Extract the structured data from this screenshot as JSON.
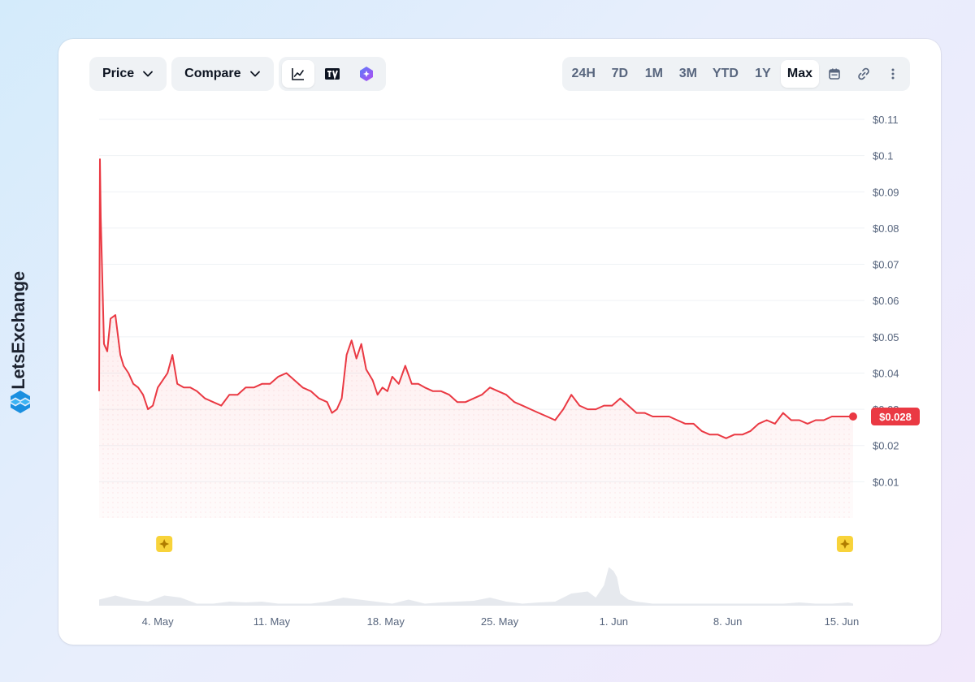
{
  "brand": {
    "name": "LetsExchange"
  },
  "toolbar": {
    "price_label": "Price",
    "compare_label": "Compare",
    "chart_modes": [
      "line-chart-icon",
      "tradingview-icon",
      "ai-icon"
    ],
    "ranges": [
      "24H",
      "7D",
      "1M",
      "3M",
      "YTD",
      "1Y",
      "Max"
    ],
    "active_range": "Max"
  },
  "colors": {
    "line": "#ea3943",
    "grid": "#eff2f5",
    "volume": "#e6e9ee",
    "event_marker": "#f8d33a"
  },
  "chart_data": {
    "type": "area",
    "currency_prefix": "$",
    "ylim": [
      0.0,
      0.11
    ],
    "yticks": [
      "$0.11",
      "$0.1",
      "$0.09",
      "$0.08",
      "$0.07",
      "$0.06",
      "$0.05",
      "$0.04",
      "$0.03",
      "$0.02",
      "$0.01"
    ],
    "ytick_values": [
      0.11,
      0.1,
      0.09,
      0.08,
      0.07,
      0.06,
      0.05,
      0.04,
      0.03,
      0.02,
      0.01
    ],
    "xticks": [
      "4. May",
      "11. May",
      "18. May",
      "25. May",
      "1. Jun",
      "8. Jun",
      "15. Jun"
    ],
    "xtick_days": [
      3.6,
      10.6,
      17.6,
      24.6,
      31.6,
      38.6,
      45.6
    ],
    "x_range_days": [
      0,
      47
    ],
    "series": [
      {
        "x": [
          0,
          0.05,
          0.1,
          0.3,
          0.5,
          0.7,
          1.0,
          1.3,
          1.5,
          1.8,
          2.1,
          2.4,
          2.7,
          3.0,
          3.3,
          3.6,
          3.9,
          4.2,
          4.5,
          4.8,
          5.2,
          5.6,
          6.0,
          6.5,
          7.0,
          7.5,
          8.0,
          8.5,
          9.0,
          9.5,
          10.0,
          10.5,
          11.0,
          11.5,
          12.0,
          12.5,
          13.0,
          13.5,
          14.0,
          14.3,
          14.6,
          14.9,
          15.2,
          15.5,
          15.8,
          16.1,
          16.4,
          16.8,
          17.1,
          17.4,
          17.7,
          18.0,
          18.4,
          18.8,
          19.2,
          19.6,
          20.0,
          20.5,
          21.0,
          21.5,
          22.0,
          22.5,
          23.0,
          23.5,
          24.0,
          24.5,
          25.0,
          25.5,
          26.0,
          26.5,
          27.0,
          27.5,
          28.0,
          28.5,
          29.0,
          29.5,
          30.0,
          30.5,
          31.0,
          31.5,
          32.0,
          32.5,
          33.0,
          33.5,
          34.0,
          34.5,
          35.0,
          35.5,
          36.0,
          36.5,
          37.0,
          37.5,
          38.0,
          38.5,
          39.0,
          39.5,
          40.0,
          40.5,
          41.0,
          41.5,
          42.0,
          42.5,
          43.0,
          43.5,
          44.0,
          44.5,
          45.0,
          45.5,
          46.0,
          46.3
        ],
        "y": [
          0.035,
          0.099,
          0.083,
          0.048,
          0.046,
          0.055,
          0.056,
          0.045,
          0.042,
          0.04,
          0.037,
          0.036,
          0.034,
          0.03,
          0.031,
          0.036,
          0.038,
          0.04,
          0.045,
          0.037,
          0.036,
          0.036,
          0.035,
          0.033,
          0.032,
          0.031,
          0.034,
          0.034,
          0.036,
          0.036,
          0.037,
          0.037,
          0.039,
          0.04,
          0.038,
          0.036,
          0.035,
          0.033,
          0.032,
          0.029,
          0.03,
          0.033,
          0.045,
          0.049,
          0.044,
          0.048,
          0.041,
          0.038,
          0.034,
          0.036,
          0.035,
          0.039,
          0.037,
          0.042,
          0.037,
          0.037,
          0.036,
          0.035,
          0.035,
          0.034,
          0.032,
          0.032,
          0.033,
          0.034,
          0.036,
          0.035,
          0.034,
          0.032,
          0.031,
          0.03,
          0.029,
          0.028,
          0.027,
          0.03,
          0.034,
          0.031,
          0.03,
          0.03,
          0.031,
          0.031,
          0.033,
          0.031,
          0.029,
          0.029,
          0.028,
          0.028,
          0.028,
          0.027,
          0.026,
          0.026,
          0.024,
          0.023,
          0.023,
          0.022,
          0.023,
          0.023,
          0.024,
          0.026,
          0.027,
          0.026,
          0.029,
          0.027,
          0.027,
          0.026,
          0.027,
          0.027,
          0.028,
          0.028,
          0.028,
          0.028
        ]
      }
    ],
    "current_price_label": "$0.028",
    "current_price": 0.028,
    "volume_series": {
      "x": [
        0,
        1,
        2,
        3,
        4,
        5,
        6,
        7,
        8,
        9,
        10,
        11,
        12,
        13,
        14,
        15,
        16,
        17,
        18,
        19,
        20,
        21,
        22,
        23,
        24,
        25,
        26,
        27,
        28,
        29,
        30,
        30.5,
        31,
        31.3,
        31.6,
        31.8,
        32,
        32.5,
        33,
        34,
        35,
        36,
        37,
        38,
        39,
        40,
        41,
        42,
        43,
        44,
        45,
        46,
        46.3
      ],
      "y": [
        0.15,
        0.25,
        0.15,
        0.1,
        0.25,
        0.2,
        0.05,
        0.05,
        0.1,
        0.08,
        0.1,
        0.05,
        0.05,
        0.05,
        0.1,
        0.2,
        0.15,
        0.1,
        0.05,
        0.15,
        0.05,
        0.08,
        0.1,
        0.12,
        0.2,
        0.1,
        0.05,
        0.08,
        0.1,
        0.3,
        0.35,
        0.2,
        0.5,
        0.95,
        0.85,
        0.7,
        0.3,
        0.15,
        0.1,
        0.05,
        0.05,
        0.05,
        0.05,
        0.05,
        0.05,
        0.05,
        0.05,
        0.05,
        0.08,
        0.05,
        0.05,
        0.08,
        0.05
      ]
    },
    "event_markers_days": [
      4.0,
      45.8
    ],
    "grid": true
  }
}
